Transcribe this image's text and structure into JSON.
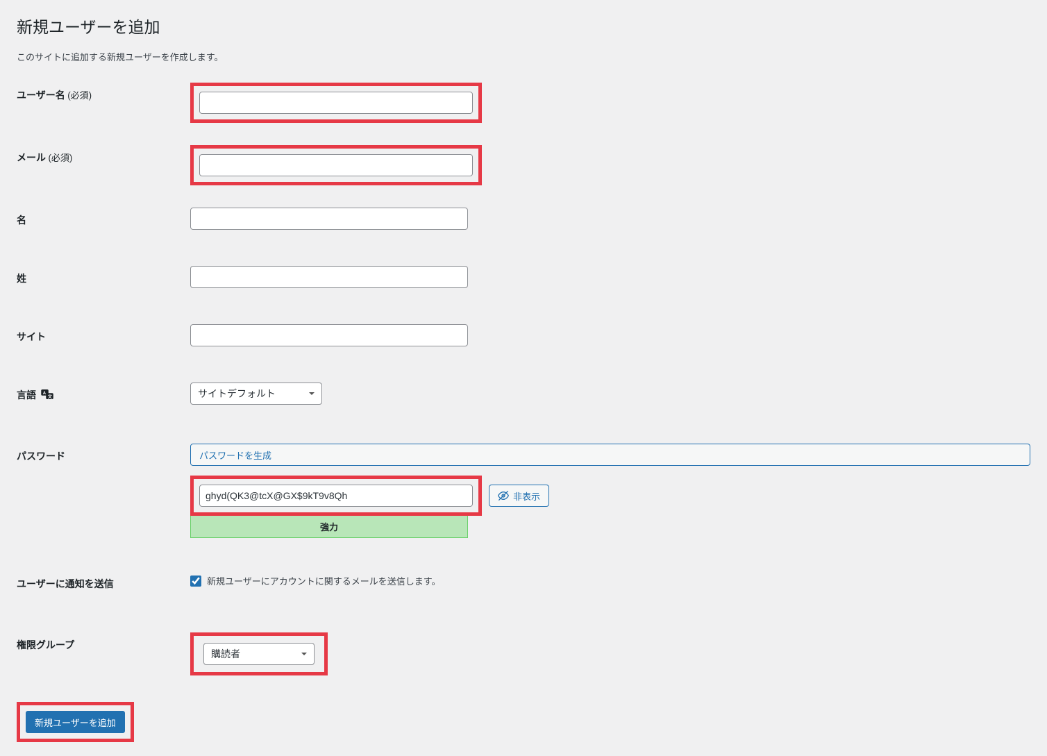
{
  "page": {
    "title": "新規ユーザーを追加",
    "description": "このサイトに追加する新規ユーザーを作成します。"
  },
  "labels": {
    "username": "ユーザー名",
    "required": "(必須)",
    "email": "メール",
    "first_name": "名",
    "last_name": "姓",
    "website": "サイト",
    "language": "言語",
    "password": "パスワード",
    "send_notification": "ユーザーに通知を送信",
    "role": "権限グループ"
  },
  "fields": {
    "username_value": "",
    "email_value": "",
    "first_name_value": "",
    "last_name_value": "",
    "website_value": "",
    "language_selected": "サイトデフォルト",
    "password_value": "ghyd(QK3@tcX@GX$9kT9v8Qh",
    "role_selected": "購読者"
  },
  "buttons": {
    "generate_password": "パスワードを生成",
    "hide": "非表示",
    "submit": "新規ユーザーを追加"
  },
  "password_strength": "強力",
  "notification_checkbox_label": "新規ユーザーにアカウントに関するメールを送信します。",
  "notification_checked": true
}
